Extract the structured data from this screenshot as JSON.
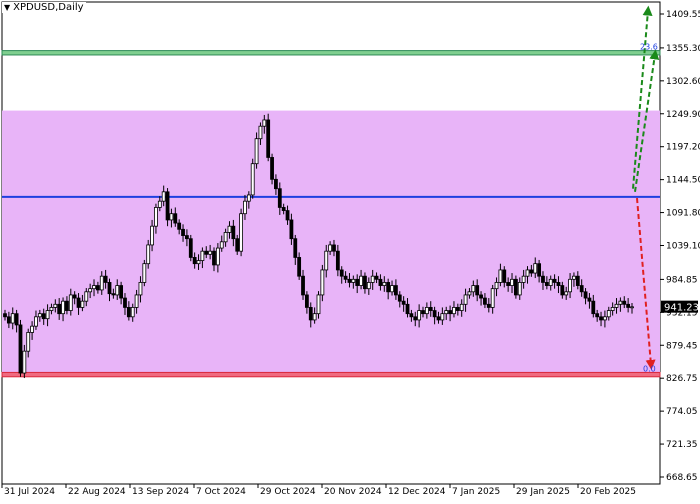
{
  "chart_title": "XPDUSD,Daily",
  "title_arrow": "▼",
  "current_price_label": "941.23",
  "fib_top_label": "23.6",
  "fib_bottom_label": "0.0",
  "colors": {
    "background": "#ffffff",
    "zone_fill": "#e8b4f8",
    "green_band": "#7fcf8f",
    "green_band_edge": "#2e8b57",
    "red_band": "#f06a80",
    "red_band_edge": "#d9283d",
    "blue_line": "#1e3fe0",
    "candle": "#000000",
    "arrow_green": "#1a8a1a",
    "arrow_red": "#e02020"
  },
  "chart_data": {
    "type": "candlestick",
    "symbol": "XPDUSD",
    "timeframe": "Daily",
    "y_ticks": [
      "1409.55",
      "1355.30",
      "1302.60",
      "1249.90",
      "1197.20",
      "1144.50",
      "1091.80",
      "1039.10",
      "984.85",
      "932.15",
      "879.45",
      "826.75",
      "774.05",
      "721.35",
      "668.65"
    ],
    "x_ticks": [
      "31 Jul 2024",
      "22 Aug 2024",
      "13 Sep 2024",
      "7 Oct 2024",
      "29 Oct 2024",
      "20 Nov 2024",
      "12 Dec 2024",
      "7 Jan 2025",
      "29 Jan 2025",
      "20 Feb 2025"
    ],
    "ylim": [
      655,
      1425
    ],
    "last_price": 941.23,
    "levels": {
      "zone_top": 1255,
      "zone_bottom": 835,
      "green_band": [
        1344,
        1351
      ],
      "blue_line": 1117,
      "red_band": [
        829,
        836
      ]
    },
    "closes": [
      925,
      915,
      930,
      912,
      835,
      870,
      900,
      910,
      925,
      930,
      922,
      935,
      940,
      945,
      930,
      950,
      935,
      960,
      955,
      940,
      950,
      965,
      970,
      975,
      968,
      990,
      980,
      962,
      960,
      975,
      955,
      940,
      925,
      940,
      960,
      980,
      1010,
      1040,
      1070,
      1100,
      1110,
      1125,
      1080,
      1090,
      1075,
      1065,
      1055,
      1050,
      1020,
      1010,
      1015,
      1030,
      1025,
      1030,
      1008,
      1035,
      1045,
      1060,
      1070,
      1050,
      1030,
      1090,
      1110,
      1120,
      1170,
      1210,
      1230,
      1240,
      1180,
      1145,
      1130,
      1100,
      1095,
      1080,
      1050,
      1020,
      990,
      960,
      940,
      920,
      930,
      960,
      1000,
      1030,
      1040,
      1030,
      1000,
      990,
      985,
      980,
      985,
      975,
      990,
      970,
      980,
      990,
      985,
      975,
      980,
      965,
      975,
      960,
      950,
      945,
      930,
      925,
      920,
      935,
      930,
      940,
      935,
      925,
      920,
      930,
      935,
      930,
      940,
      935,
      945,
      960,
      965,
      975,
      960,
      955,
      945,
      940,
      970,
      980,
      1000,
      980,
      975,
      985,
      960,
      980,
      990,
      1000,
      995,
      1010,
      990,
      980,
      975,
      985,
      980,
      975,
      960,
      965,
      985,
      990,
      975,
      965,
      955,
      950,
      930,
      925,
      920,
      925,
      935,
      940,
      945,
      950,
      945,
      940,
      941
    ]
  }
}
